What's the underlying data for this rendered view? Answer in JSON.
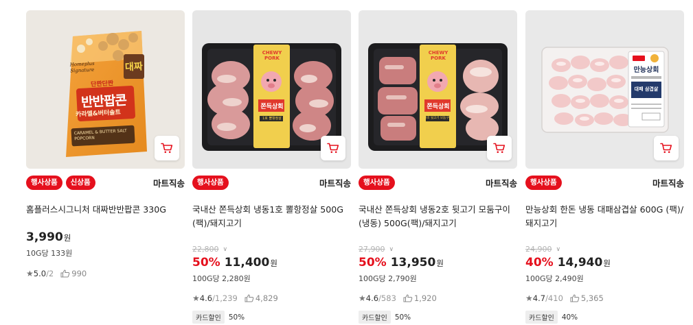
{
  "colors": {
    "accent": "#e5101d",
    "tray": "#1c1c1e",
    "label": "#f1cf4d"
  },
  "products": [
    {
      "badges": [
        "행사상품",
        "신상품"
      ],
      "seller": "마트직송",
      "title": "홈플러스시그니처 대짜반반팝콘 330G",
      "original_price": "",
      "discount": "",
      "price": "3,990",
      "won": "원",
      "unit_price": "10G당 133원",
      "rating": "5.0",
      "review_count": "/2",
      "likes": "990",
      "card_tag": "",
      "card_discount": "",
      "package_text": {
        "brand": "Homeplus Signature",
        "big": "대짜",
        "subtitle": "단짠단짠",
        "name": "반반팝콘",
        "flavor": "카라멜&버터솔트",
        "en": "CARAMEL & BUTTER SALT POPCORN"
      },
      "image_icon": "popcorn-bag-icon"
    },
    {
      "badges": [
        "행사상품"
      ],
      "seller": "마트직송",
      "title": "국내산 쫀득상회 냉동1호 뽈항정살 500G (팩)/돼지고기",
      "original_price": "22,800",
      "discount": "50%",
      "price": "11,400",
      "won": "원",
      "unit_price": "100G당 2,280원",
      "rating": "4.6",
      "review_count": "/1,239",
      "likes": "4,829",
      "card_tag": "카드할인",
      "card_discount": "50%",
      "package_text": {
        "en": "CHEWY PORK",
        "name": "쫀득상회",
        "no": "1호 뽈항정살"
      },
      "image_icon": "pork-tray-icon"
    },
    {
      "badges": [
        "행사상품"
      ],
      "seller": "마트직송",
      "title": "국내산 쫀득상회 냉동2호 뒷고기 모둠구이(냉동) 500G(팩)/돼지고기",
      "original_price": "27,900",
      "discount": "50%",
      "price": "13,950",
      "won": "원",
      "unit_price": "100G당 2,790원",
      "rating": "4.6",
      "review_count": "/583",
      "likes": "1,920",
      "card_tag": "카드할인",
      "card_discount": "50%",
      "package_text": {
        "en": "CHEWY PORK",
        "name": "쫀득상회",
        "no": "2호 뒷고기 모둠구이"
      },
      "image_icon": "pork-tray-icon"
    },
    {
      "badges": [
        "행사상품"
      ],
      "seller": "마트직송",
      "title": "만능상회 한돈 냉동 대패삼겹살 600G (팩)/돼지고기",
      "original_price": "24,900",
      "discount": "40%",
      "price": "14,940",
      "won": "원",
      "unit_price": "100G당 2,490원",
      "rating": "4.7",
      "review_count": "/410",
      "likes": "5,365",
      "card_tag": "카드할인",
      "card_discount": "40%",
      "package_text": {
        "name": "만능상회",
        "sub": "대패 삼겹살"
      },
      "image_icon": "pork-rolls-pack-icon"
    }
  ]
}
